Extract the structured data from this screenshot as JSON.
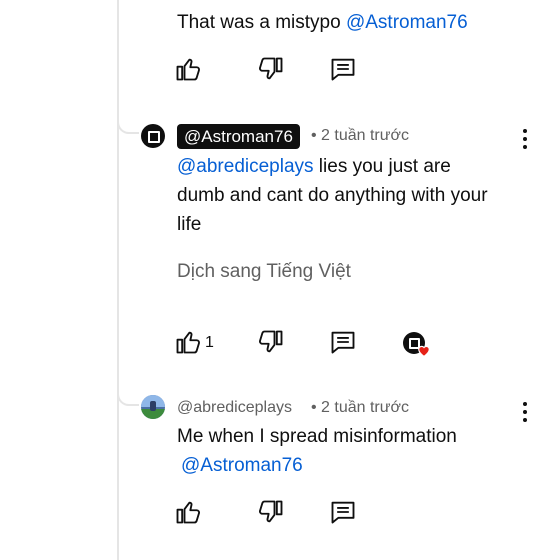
{
  "comment_top": {
    "text_prefix": "That was a  mistypo ",
    "mention": "@Astroman76"
  },
  "reply_astroman": {
    "author": "@Astroman76",
    "time": "• 2 tuần trước",
    "mention": "@abrediceplays",
    "text_line1": " lies you just are",
    "text_line2": "dumb and cant do anything with your",
    "text_line3": "life",
    "translate": "Dịch sang Tiếng Việt",
    "like_count": "1"
  },
  "reply_abrediceplays": {
    "author": "@abrediceplays",
    "time": "• 2 tuần trước",
    "text_line1": "Me when I spread misinformation",
    "mention": "@Astroman76"
  },
  "icons": {
    "like": "thumb-up-icon",
    "dislike": "thumb-down-icon",
    "reply": "comment-icon",
    "more": "more-vertical-icon",
    "creator_heart": "creator-heart-icon"
  },
  "colors": {
    "mention": "#065fd4",
    "meta": "#606060",
    "heart": "#e62117"
  }
}
